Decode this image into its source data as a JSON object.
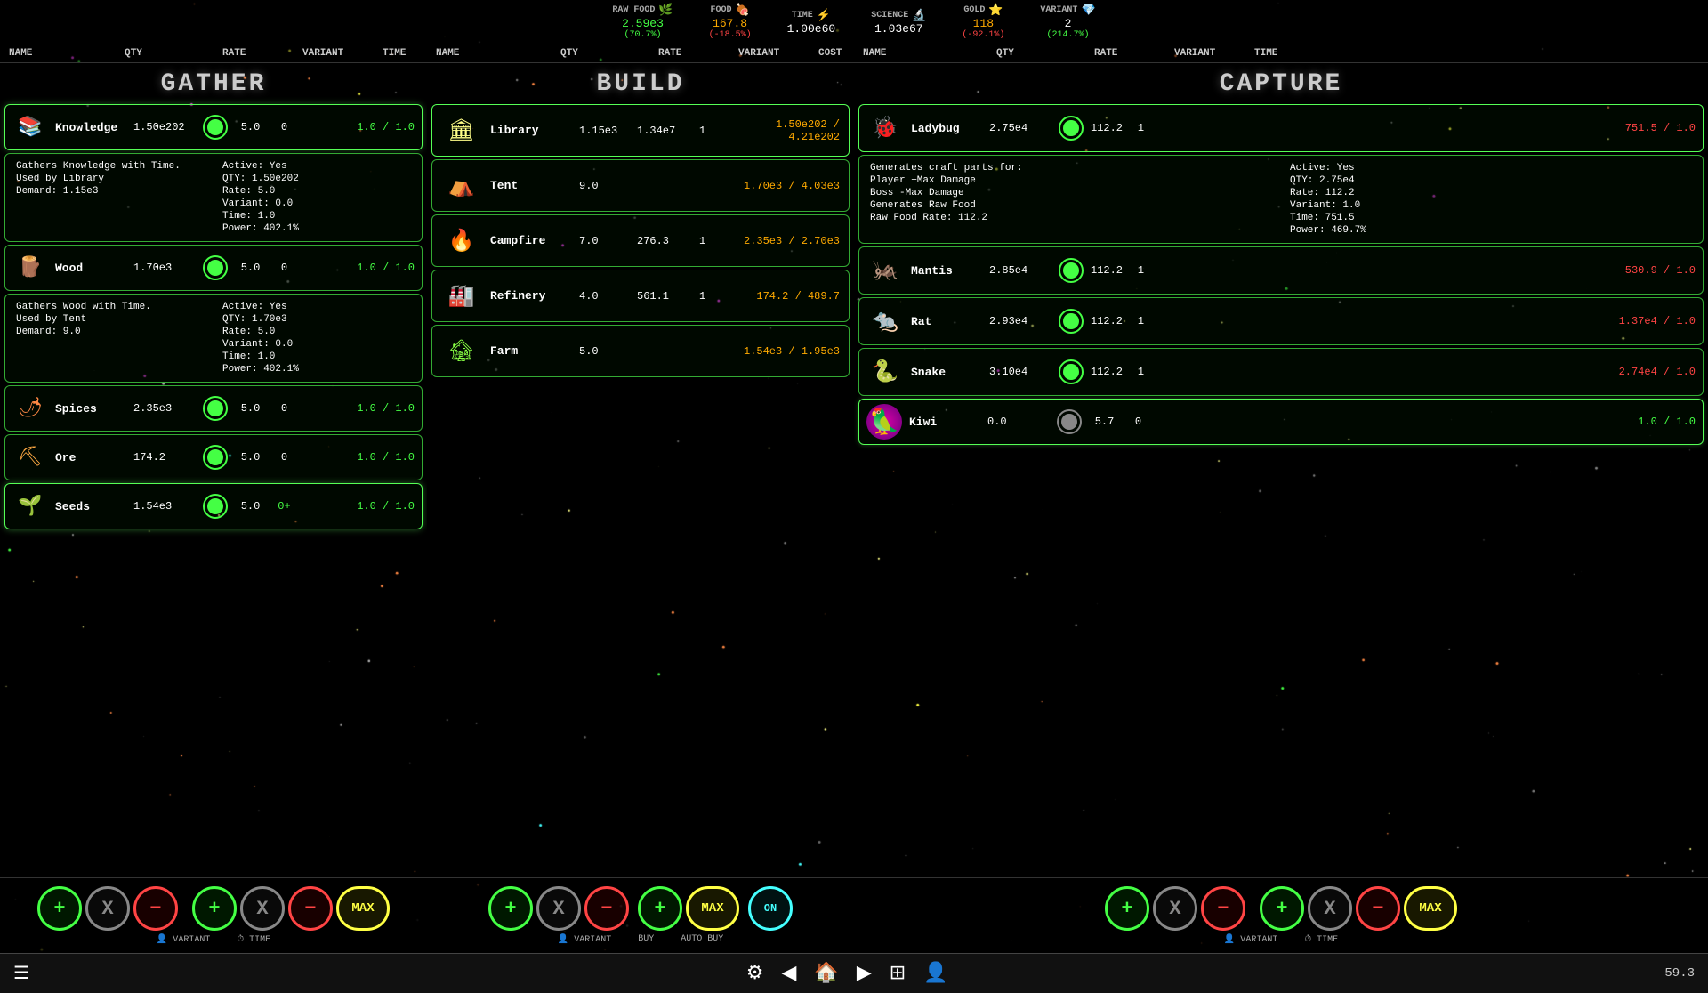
{
  "topBar": {
    "resources": [
      {
        "label": "RAW FOOD",
        "icon": "🌿",
        "value": "2.59e3",
        "change": "(70.7%)",
        "changeType": "positive"
      },
      {
        "label": "FOOD",
        "icon": "🍖",
        "value": "167.8",
        "change": "(-18.5%)",
        "changeType": "negative"
      },
      {
        "label": "TIME",
        "icon": "⏱",
        "value": "1.00e60",
        "change": "",
        "changeType": "neutral"
      },
      {
        "label": "SCIENCE",
        "icon": "🔬",
        "value": "1.03e67",
        "change": "",
        "changeType": "neutral"
      },
      {
        "label": "GOLD",
        "icon": "⭐",
        "value": "118",
        "change": "(-92.1%)",
        "changeType": "negative"
      },
      {
        "label": "VARIANT",
        "icon": "💎",
        "value": "2",
        "change": "(214.7%)",
        "changeType": "positive"
      }
    ]
  },
  "sections": {
    "gather": "GATHER",
    "build": "BUILD",
    "capture": "CAPTURE"
  },
  "columnHeaders": {
    "left": [
      "NAME",
      "QTY",
      "RATE",
      "VARIANT",
      "TIME"
    ],
    "middle": [
      "NAME",
      "QTY",
      "RATE",
      "VARIANT",
      "COST"
    ],
    "right": [
      "NAME",
      "QTY",
      "RATE",
      "VARIANT",
      "TIME"
    ]
  },
  "gatherItems": [
    {
      "name": "Knowledge",
      "icon": "📚",
      "qty": "1.50e202",
      "rate": "5.0",
      "variant": "0",
      "time": "1.0 / 1.0"
    },
    {
      "name": "Wood",
      "icon": "🪵",
      "qty": "1.70e3",
      "rate": "5.0",
      "variant": "0",
      "time": "1.0 / 1.0"
    },
    {
      "name": "Spices",
      "icon": "🌶",
      "qty": "2.35e3",
      "rate": "5.0",
      "variant": "0",
      "time": "1.0 / 1.0"
    },
    {
      "name": "Ore",
      "icon": "⛏",
      "qty": "174.2",
      "rate": "5.0",
      "variant": "0",
      "time": "1.0 / 1.0"
    },
    {
      "name": "Seeds",
      "icon": "🌱",
      "qty": "1.54e3",
      "rate": "5.0",
      "variant": "0+",
      "time": "1.0 / 1.0"
    }
  ],
  "knowledgeInfo": {
    "left": [
      "Gathers Knowledge with Time.",
      "Used by Library",
      "Demand: 1.15e3"
    ],
    "right": [
      "Active: Yes",
      "QTY: 1.50e202",
      "Rate: 5.0",
      "Variant: 0.0",
      "Time: 1.0",
      "Power: 402.1%"
    ]
  },
  "woodInfo": {
    "left": [
      "Gathers Wood with Time.",
      "Used by Tent",
      "Demand: 9.0"
    ],
    "right": [
      "Active: Yes",
      "QTY: 1.70e3",
      "Rate: 5.0",
      "Variant: 0.0",
      "Time: 1.0",
      "Power: 402.1%"
    ]
  },
  "buildItems": [
    {
      "name": "Library",
      "icon": "🏛",
      "qty": "1.15e3",
      "rate": "1.34e7",
      "variant": "1",
      "cost": "1.50e202 / 4.21e202"
    },
    {
      "name": "Tent",
      "icon": "⛺",
      "qty": "9.0",
      "rate": "",
      "variant": "",
      "cost": "1.70e3 / 4.03e3"
    },
    {
      "name": "Campfire",
      "icon": "🔥",
      "qty": "7.0",
      "rate": "276.3",
      "variant": "1",
      "cost": "2.35e3 / 2.70e3"
    },
    {
      "name": "Refinery",
      "icon": "🏭",
      "qty": "4.0",
      "rate": "561.1",
      "variant": "1",
      "cost": "174.2 / 489.7"
    },
    {
      "name": "Farm",
      "icon": "🏚",
      "qty": "5.0",
      "rate": "",
      "variant": "",
      "cost": "1.54e3 / 1.95e3"
    }
  ],
  "captureItems": [
    {
      "name": "Ladybug",
      "icon": "🐞",
      "qty": "2.75e4",
      "rate": "112.2",
      "variant": "1",
      "time": "751.5 / 1.0",
      "timeColor": "red"
    },
    {
      "name": "Mantis",
      "icon": "🦗",
      "qty": "2.85e4",
      "rate": "112.2",
      "variant": "1",
      "time": "530.9 / 1.0",
      "timeColor": "red"
    },
    {
      "name": "Rat",
      "icon": "🐀",
      "qty": "2.93e4",
      "rate": "112.2",
      "variant": "1",
      "time": "1.37e4 / 1.0",
      "timeColor": "red"
    },
    {
      "name": "Snake",
      "icon": "🐍",
      "qty": "3.10e4",
      "rate": "112.2",
      "variant": "1",
      "time": "2.74e4 / 1.0",
      "timeColor": "red"
    },
    {
      "name": "Kiwi",
      "icon": "🦜",
      "qty": "0.0",
      "rate": "5.7",
      "variant": "0",
      "time": "1.0 / 1.0",
      "timeColor": "green"
    }
  ],
  "ladybugInfo": {
    "left": [
      "Generates craft parts for:",
      "Player +Max Damage",
      "Boss -Max Damage",
      "Generates Raw Food",
      "Raw Food Rate: 112.2"
    ],
    "right": [
      "Active: Yes",
      "QTY: 2.75e4",
      "Rate: 112.2",
      "Variant: 1.0",
      "Time: 751.5",
      "Power: 469.7%"
    ]
  },
  "controls": {
    "gather": {
      "group1": {
        "plus": "+",
        "x": "X",
        "minus": "-"
      },
      "group2": {
        "plus": "+",
        "x": "X",
        "minus": "-",
        "max": "MAX"
      },
      "labels": [
        "VARIANT",
        "TIME"
      ]
    },
    "build": {
      "group1": {
        "plus": "+",
        "x": "X",
        "minus": "-",
        "max": "MAX"
      },
      "autobuy": "ON",
      "labels": [
        "VARIANT",
        "BUY",
        "AUTO BUY"
      ]
    },
    "capture": {
      "group1": {
        "plus": "+",
        "x": "X",
        "minus": "-"
      },
      "group2": {
        "plus": "+",
        "x": "X",
        "minus": "-",
        "max": "MAX"
      },
      "labels": [
        "VARIANT",
        "TIME"
      ]
    }
  },
  "bottomNav": {
    "hamburger": "☰",
    "buttons": [
      "⚙",
      "◀",
      "🏠",
      "▶",
      "⊞",
      "👤"
    ],
    "version": "59.3"
  }
}
